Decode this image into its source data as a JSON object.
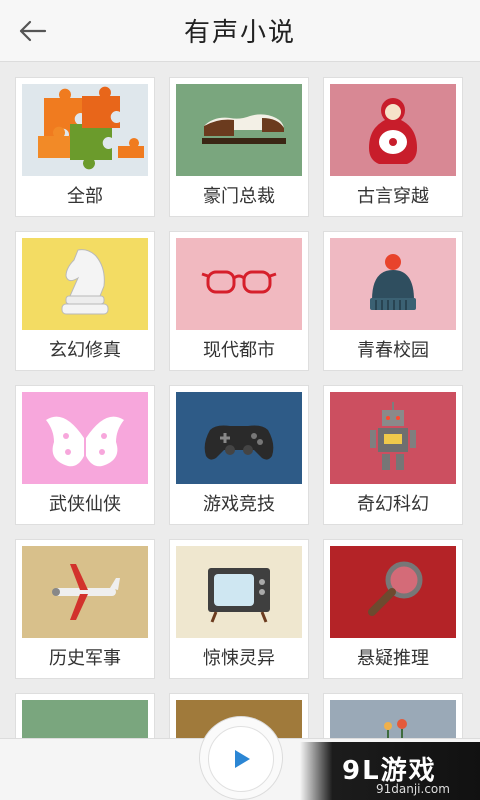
{
  "header": {
    "title": "有声小说",
    "back_icon": "arrow-left-icon"
  },
  "categories": [
    {
      "label": "全部",
      "thumb_bg": "#dfe7ec",
      "icon": "puzzle-icon"
    },
    {
      "label": "豪门总裁",
      "thumb_bg": "#7aa67e",
      "icon": "shoe-icon"
    },
    {
      "label": "古言穿越",
      "thumb_bg": "#d88894",
      "icon": "matryoshka-icon"
    },
    {
      "label": "玄幻修真",
      "thumb_bg": "#f3dc63",
      "icon": "chess-knight-icon"
    },
    {
      "label": "现代都市",
      "thumb_bg": "#f1b9c0",
      "icon": "glasses-icon"
    },
    {
      "label": "青春校园",
      "thumb_bg": "#efb9c2",
      "icon": "beanie-hat-icon"
    },
    {
      "label": "武侠仙侠",
      "thumb_bg": "#f7a7dc",
      "icon": "butterfly-icon"
    },
    {
      "label": "游戏竞技",
      "thumb_bg": "#2e5b87",
      "icon": "gamepad-icon"
    },
    {
      "label": "奇幻科幻",
      "thumb_bg": "#cc4f60",
      "icon": "robot-icon"
    },
    {
      "label": "历史军事",
      "thumb_bg": "#d8c08b",
      "icon": "airplane-icon"
    },
    {
      "label": "惊悚灵异",
      "thumb_bg": "#efe7cf",
      "icon": "tv-icon"
    },
    {
      "label": "悬疑推理",
      "thumb_bg": "#b42327",
      "icon": "magnifier-icon"
    },
    {
      "label": "",
      "thumb_bg": "#7aa67e",
      "icon": ""
    },
    {
      "label": "",
      "thumb_bg": "#a07a3b",
      "icon": ""
    },
    {
      "label": "",
      "thumb_bg": "#9aa9b7",
      "icon": ""
    }
  ],
  "player": {
    "play_icon": "play-icon"
  },
  "watermark": {
    "main": "9L游戏",
    "sub": "91danji.com"
  }
}
